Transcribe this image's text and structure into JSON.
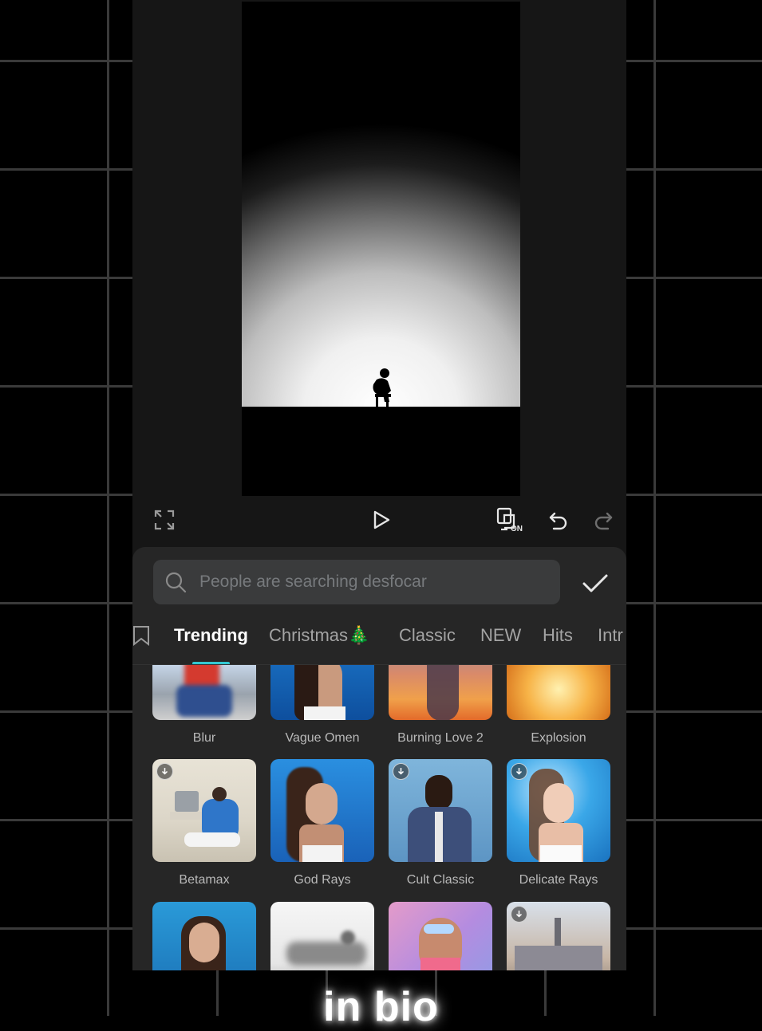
{
  "search": {
    "placeholder": "People are searching desfocar"
  },
  "tabs": [
    "Trending",
    "Christmas🎄",
    "Classic",
    "NEW",
    "Hits",
    "Intr"
  ],
  "active_tab": "Trending",
  "effects_row1": [
    "Blur",
    "Vague Omen",
    "Burning Love 2",
    "Explosion"
  ],
  "effects_row2": [
    "Betamax",
    "God Rays",
    "Cult Classic",
    "Delicate Rays"
  ],
  "toolbar": {
    "preview_toggle_badge": "ON"
  },
  "caption": "in bio",
  "colors": {
    "accent": "#33c7d1",
    "sheet_bg": "#262626",
    "app_bg": "#161616"
  }
}
